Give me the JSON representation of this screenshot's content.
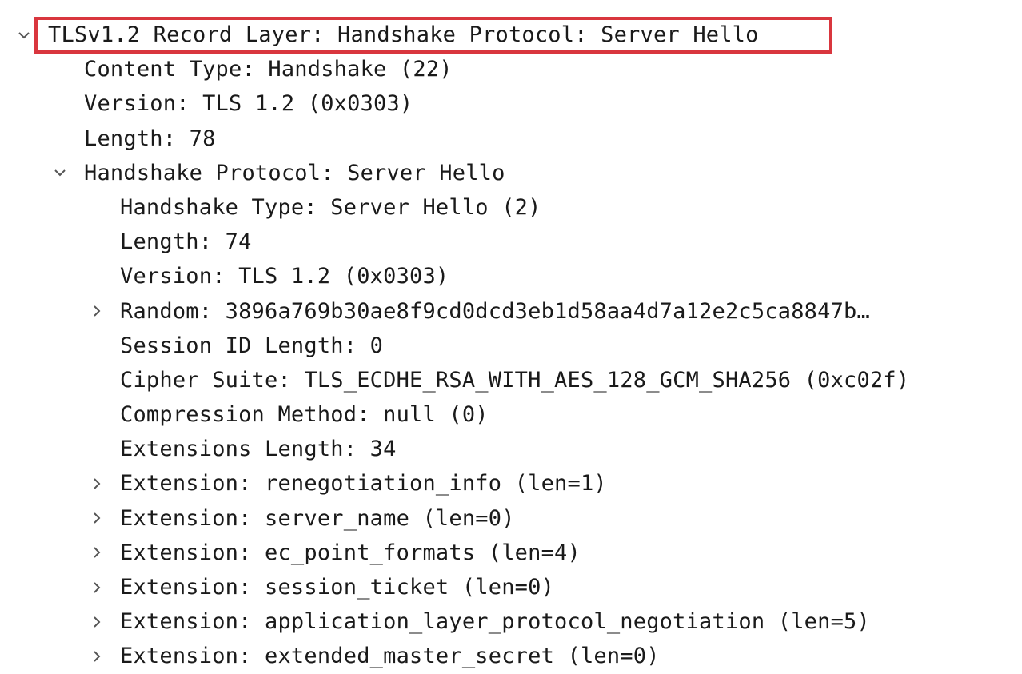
{
  "tree": {
    "record_layer": "TLSv1.2 Record Layer: Handshake Protocol: Server Hello",
    "content_type": "Content Type: Handshake (22)",
    "version": "Version: TLS 1.2 (0x0303)",
    "length": "Length: 78",
    "handshake_protocol": "Handshake Protocol: Server Hello",
    "handshake": {
      "type": "Handshake Type: Server Hello (2)",
      "length": "Length: 74",
      "version": "Version: TLS 1.2 (0x0303)",
      "random": "Random: 3896a769b30ae8f9cd0dcd3eb1d58aa4d7a12e2c5ca8847b…",
      "session_id_length": "Session ID Length: 0",
      "cipher_suite": "Cipher Suite: TLS_ECDHE_RSA_WITH_AES_128_GCM_SHA256 (0xc02f)",
      "compression_method": "Compression Method: null (0)",
      "extensions_length": "Extensions Length: 34",
      "extensions": [
        "Extension: renegotiation_info (len=1)",
        "Extension: server_name (len=0)",
        "Extension: ec_point_formats (len=4)",
        "Extension: session_ticket (len=0)",
        "Extension: application_layer_protocol_negotiation (len=5)",
        "Extension: extended_master_secret (len=0)"
      ]
    }
  },
  "icons": {
    "expanded": "chevron-down-icon",
    "collapsed": "chevron-right-icon"
  },
  "colors": {
    "highlight": "#d9363e",
    "text": "#1a1a1a",
    "chevron": "#555555"
  }
}
